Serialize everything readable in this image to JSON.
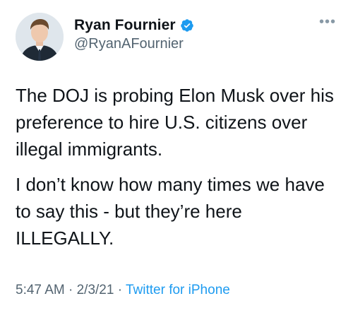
{
  "user": {
    "display_name": "Ryan Fournier",
    "handle": "@RyanAFournier"
  },
  "tweet": {
    "paragraphs": [
      "The DOJ is probing Elon Musk over his preference to hire U.S. citizens over illegal immigrants.",
      "I don’t know how many times we have to say this - but they’re here ILLEGALLY."
    ],
    "time": "5:47 AM",
    "separator": "·",
    "date": "2/3/21",
    "source": "Twitter for iPhone"
  },
  "icons": {
    "verified": "verified-badge-icon",
    "more": "more-options-icon"
  },
  "colors": {
    "accent": "#1d9bf0",
    "secondary_text": "#536471"
  }
}
